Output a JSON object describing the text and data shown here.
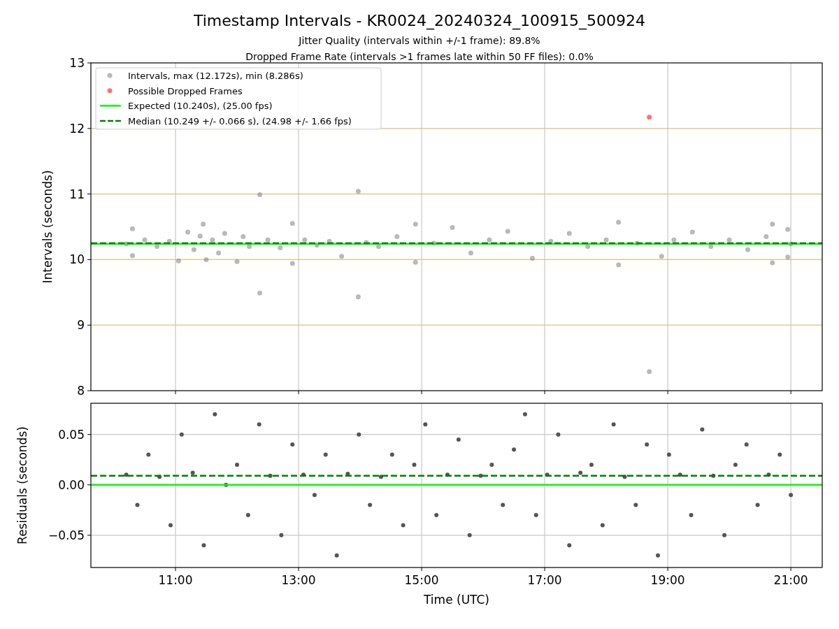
{
  "title": "Timestamp Intervals - KR0024_20240324_100915_500924",
  "subtitles": [
    "Jitter Quality (intervals within +/-1 frame): 89.8%",
    "Dropped Frame Rate (intervals >1 frames late within 50 FF files): 0.0%"
  ],
  "intervals_plot": {
    "chart_data": {
      "type": "scatter",
      "ylabel": "Intervals (seconds)",
      "xlim": [
        9.625,
        21.51
      ],
      "ylim": [
        8,
        13
      ],
      "grid": true,
      "legend": "upper left",
      "yticks": [
        {
          "value": 8,
          "label": "8"
        },
        {
          "value": 9,
          "label": "9"
        },
        {
          "value": 10,
          "label": "10"
        },
        {
          "value": 11,
          "label": "11"
        },
        {
          "value": 12,
          "label": "12"
        },
        {
          "value": 13,
          "label": "13"
        }
      ],
      "series": [
        {
          "name": "Intervals, max (12.172s), min (8.286s)",
          "type": "scatter",
          "color": "#808080",
          "x": [
            10.2,
            10.3,
            10.3,
            10.5,
            10.7,
            10.9,
            11.05,
            11.2,
            11.3,
            11.4,
            11.45,
            11.5,
            11.6,
            11.7,
            11.8,
            12.0,
            12.1,
            12.2,
            12.37,
            12.37,
            12.5,
            12.7,
            12.9,
            12.9,
            13.1,
            13.3,
            13.5,
            13.7,
            13.97,
            13.97,
            14.1,
            14.3,
            14.6,
            14.9,
            14.9,
            15.2,
            15.5,
            15.8,
            16.1,
            16.4,
            16.8,
            17.1,
            17.4,
            17.7,
            18.0,
            18.2,
            18.2,
            18.5,
            18.9,
            19.1,
            19.4,
            19.7,
            20.0,
            20.3,
            20.6,
            20.7,
            20.7,
            20.95,
            20.95,
            21.0,
            18.7
          ],
          "values": [
            10.24,
            10.47,
            10.06,
            10.3,
            10.2,
            10.28,
            9.98,
            10.42,
            10.15,
            10.36,
            10.54,
            10.0,
            10.3,
            10.1,
            10.4,
            9.97,
            10.35,
            10.2,
            10.99,
            9.49,
            10.3,
            10.18,
            10.55,
            9.94,
            10.3,
            10.22,
            10.28,
            10.05,
            11.04,
            9.43,
            10.26,
            10.2,
            10.35,
            10.54,
            9.96,
            10.25,
            10.49,
            10.1,
            10.3,
            10.43,
            10.02,
            10.28,
            10.4,
            10.2,
            10.3,
            10.57,
            9.92,
            10.25,
            10.05,
            10.3,
            10.42,
            10.2,
            10.3,
            10.15,
            10.35,
            10.54,
            9.95,
            10.46,
            10.04,
            10.24,
            8.29
          ]
        },
        {
          "name": "Possible Dropped Frames",
          "type": "scatter",
          "color": "#ff0000",
          "x": [
            18.7
          ],
          "values": [
            12.17
          ]
        },
        {
          "name": "Expected (10.240s), (25.00 fps)",
          "type": "line",
          "line_style": "solid",
          "color": "#00ff00",
          "x": [
            9.625,
            21.51
          ],
          "values": [
            10.24,
            10.24
          ]
        },
        {
          "name": "Median (10.249 +/- 0.066 s), (24.98 +/- 1.66 fps)",
          "type": "line",
          "line_style": "dashed",
          "color": "#008000",
          "x": [
            9.625,
            21.51
          ],
          "values": [
            10.249,
            10.249
          ]
        }
      ]
    }
  },
  "residuals_plot": {
    "chart_data": {
      "type": "scatter",
      "xlabel": "Time (UTC)",
      "ylabel": "Residuals (seconds)",
      "xlim": [
        9.625,
        21.51
      ],
      "ylim": [
        -0.082,
        0.081
      ],
      "grid": true,
      "yticks": [
        {
          "value": 0.05,
          "label": "0.05"
        },
        {
          "value": 0,
          "label": "0.00"
        },
        {
          "value": -0.05,
          "label": "−0.05"
        }
      ],
      "xticks": [
        {
          "value": 11,
          "label": "11:00"
        },
        {
          "value": 13,
          "label": "13:00"
        },
        {
          "value": 15,
          "label": "15:00"
        },
        {
          "value": 17,
          "label": "17:00"
        },
        {
          "value": 19,
          "label": "19:00"
        },
        {
          "value": 21,
          "label": "21:00"
        }
      ],
      "series": [
        {
          "type": "scatter",
          "color": "#555555",
          "x": [
            10.2,
            10.38,
            10.56,
            10.74,
            10.92,
            11.1,
            11.28,
            11.46,
            11.64,
            11.82,
            12.0,
            12.18,
            12.36,
            12.54,
            12.72,
            12.9,
            13.08,
            13.26,
            13.44,
            13.62,
            13.8,
            13.98,
            14.16,
            14.34,
            14.52,
            14.7,
            14.88,
            15.06,
            15.24,
            15.42,
            15.6,
            15.78,
            15.96,
            16.14,
            16.32,
            16.5,
            16.68,
            16.86,
            17.04,
            17.22,
            17.4,
            17.58,
            17.76,
            17.94,
            18.12,
            18.3,
            18.48,
            18.66,
            18.84,
            19.02,
            19.2,
            19.38,
            19.56,
            19.74,
            19.92,
            20.1,
            20.28,
            20.46,
            20.64,
            20.82,
            21.0
          ],
          "values": [
            0.01,
            -0.02,
            0.03,
            0.008,
            -0.04,
            0.05,
            0.012,
            -0.06,
            0.07,
            0.0,
            0.02,
            -0.03,
            0.06,
            0.009,
            -0.05,
            0.04,
            0.01,
            -0.01,
            0.03,
            -0.07,
            0.011,
            0.05,
            -0.02,
            0.008,
            0.03,
            -0.04,
            0.02,
            0.06,
            -0.03,
            0.01,
            0.045,
            -0.05,
            0.009,
            0.02,
            -0.02,
            0.035,
            0.07,
            -0.03,
            0.01,
            0.05,
            -0.06,
            0.012,
            0.02,
            -0.04,
            0.06,
            0.008,
            -0.02,
            0.04,
            -0.07,
            0.03,
            0.01,
            -0.03,
            0.055,
            0.009,
            -0.05,
            0.02,
            0.04,
            -0.02,
            0.01,
            0.03,
            -0.01
          ]
        },
        {
          "type": "line",
          "line_style": "solid",
          "color": "#00ff00",
          "x": [
            9.625,
            21.51
          ],
          "values": [
            0,
            0
          ]
        },
        {
          "type": "line",
          "line_style": "dashed",
          "color": "#008000",
          "x": [
            9.625,
            21.51
          ],
          "values": [
            0.009,
            0.009
          ]
        }
      ]
    }
  }
}
